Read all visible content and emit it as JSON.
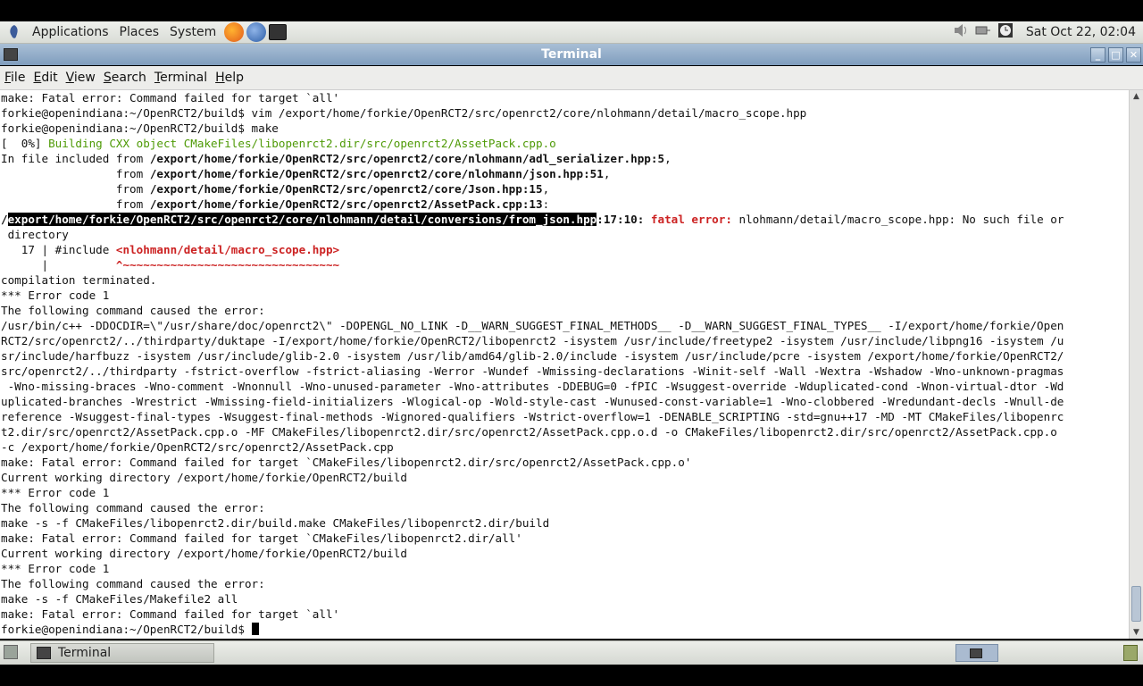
{
  "panel": {
    "menus": [
      "Applications",
      "Places",
      "System"
    ],
    "clock": "Sat Oct 22, 02:04",
    "launchers": [
      "firefox-icon",
      "thunderbird-icon",
      "terminal-launcher-icon"
    ]
  },
  "window": {
    "title": "Terminal",
    "menu": [
      "File",
      "Edit",
      "View",
      "Search",
      "Terminal",
      "Help"
    ],
    "menu_mnemonic": [
      "F",
      "E",
      "V",
      "S",
      "T",
      "H"
    ]
  },
  "terminal": {
    "lines": [
      [
        {
          "t": "make: Fatal error: Command failed for target `all'"
        }
      ],
      [
        {
          "t": "forkie@openindiana:~/OpenRCT2/build$ vim /export/home/forkie/OpenRCT2/src/openrct2/core/nlohmann/detail/macro_scope.hpp"
        }
      ],
      [
        {
          "t": "forkie@openindiana:~/OpenRCT2/build$ make"
        }
      ],
      [
        {
          "t": "[  0%] "
        },
        {
          "t": "Building CXX object CMakeFiles/libopenrct2.dir/src/openrct2/AssetPack.cpp.o",
          "c": "green"
        }
      ],
      [
        {
          "t": "In file included from "
        },
        {
          "t": "/export/home/forkie/OpenRCT2/src/openrct2/core/nlohmann/adl_serializer.hpp:5",
          "c": "bold"
        },
        {
          "t": ","
        }
      ],
      [
        {
          "t": "                 from "
        },
        {
          "t": "/export/home/forkie/OpenRCT2/src/openrct2/core/nlohmann/json.hpp:51",
          "c": "bold"
        },
        {
          "t": ","
        }
      ],
      [
        {
          "t": "                 from "
        },
        {
          "t": "/export/home/forkie/OpenRCT2/src/openrct2/core/Json.hpp:15",
          "c": "bold"
        },
        {
          "t": ","
        }
      ],
      [
        {
          "t": "                 from "
        },
        {
          "t": "/export/home/forkie/OpenRCT2/src/openrct2/AssetPack.cpp:13",
          "c": "bold"
        },
        {
          "t": ":"
        }
      ],
      [
        {
          "t": "/",
          "c": "bold"
        },
        {
          "t": "export/home/forkie/OpenRCT2/src/openrct2/core/nlohmann/detail/conversions/from_json.hpp",
          "c": "sel"
        },
        {
          "t": ":17:10: ",
          "c": "bold"
        },
        {
          "t": "fatal error: ",
          "c": "red"
        },
        {
          "t": "nlohmann/detail/macro_scope.hpp: No such file or"
        }
      ],
      [
        {
          "t": " directory"
        }
      ],
      [
        {
          "t": "   17 | #include "
        },
        {
          "t": "<nlohmann/detail/macro_scope.hpp>",
          "c": "red"
        }
      ],
      [
        {
          "t": "      |          "
        },
        {
          "t": "^~~~~~~~~~~~~~~~~~~~~~~~~~~~~~~~~",
          "c": "red"
        }
      ],
      [
        {
          "t": "compilation terminated."
        }
      ],
      [
        {
          "t": "*** Error code 1"
        }
      ],
      [
        {
          "t": "The following command caused the error:"
        }
      ],
      [
        {
          "t": "/usr/bin/c++ -DDOCDIR=\\\"/usr/share/doc/openrct2\\\" -DOPENGL_NO_LINK -D__WARN_SUGGEST_FINAL_METHODS__ -D__WARN_SUGGEST_FINAL_TYPES__ -I/export/home/forkie/Open"
        }
      ],
      [
        {
          "t": "RCT2/src/openrct2/../thirdparty/duktape -I/export/home/forkie/OpenRCT2/libopenrct2 -isystem /usr/include/freetype2 -isystem /usr/include/libpng16 -isystem /u"
        }
      ],
      [
        {
          "t": "sr/include/harfbuzz -isystem /usr/include/glib-2.0 -isystem /usr/lib/amd64/glib-2.0/include -isystem /usr/include/pcre -isystem /export/home/forkie/OpenRCT2/"
        }
      ],
      [
        {
          "t": "src/openrct2/../thirdparty -fstrict-overflow -fstrict-aliasing -Werror -Wundef -Wmissing-declarations -Winit-self -Wall -Wextra -Wshadow -Wno-unknown-pragmas"
        }
      ],
      [
        {
          "t": " -Wno-missing-braces -Wno-comment -Wnonnull -Wno-unused-parameter -Wno-attributes -DDEBUG=0 -fPIC -Wsuggest-override -Wduplicated-cond -Wnon-virtual-dtor -Wd"
        }
      ],
      [
        {
          "t": "uplicated-branches -Wrestrict -Wmissing-field-initializers -Wlogical-op -Wold-style-cast -Wunused-const-variable=1 -Wno-clobbered -Wredundant-decls -Wnull-de"
        }
      ],
      [
        {
          "t": "reference -Wsuggest-final-types -Wsuggest-final-methods -Wignored-qualifiers -Wstrict-overflow=1 -DENABLE_SCRIPTING -std=gnu++17 -MD -MT CMakeFiles/libopenrc"
        }
      ],
      [
        {
          "t": "t2.dir/src/openrct2/AssetPack.cpp.o -MF CMakeFiles/libopenrct2.dir/src/openrct2/AssetPack.cpp.o.d -o CMakeFiles/libopenrct2.dir/src/openrct2/AssetPack.cpp.o"
        }
      ],
      [
        {
          "t": "-c /export/home/forkie/OpenRCT2/src/openrct2/AssetPack.cpp"
        }
      ],
      [
        {
          "t": "make: Fatal error: Command failed for target `CMakeFiles/libopenrct2.dir/src/openrct2/AssetPack.cpp.o'"
        }
      ],
      [
        {
          "t": "Current working directory /export/home/forkie/OpenRCT2/build"
        }
      ],
      [
        {
          "t": "*** Error code 1"
        }
      ],
      [
        {
          "t": "The following command caused the error:"
        }
      ],
      [
        {
          "t": "make -s -f CMakeFiles/libopenrct2.dir/build.make CMakeFiles/libopenrct2.dir/build"
        }
      ],
      [
        {
          "t": "make: Fatal error: Command failed for target `CMakeFiles/libopenrct2.dir/all'"
        }
      ],
      [
        {
          "t": "Current working directory /export/home/forkie/OpenRCT2/build"
        }
      ],
      [
        {
          "t": "*** Error code 1"
        }
      ],
      [
        {
          "t": "The following command caused the error:"
        }
      ],
      [
        {
          "t": "make -s -f CMakeFiles/Makefile2 all"
        }
      ],
      [
        {
          "t": "make: Fatal error: Command failed for target `all'"
        }
      ],
      [
        {
          "t": "forkie@openindiana:~/OpenRCT2/build$ "
        },
        {
          "cursor": true
        }
      ]
    ]
  },
  "taskbar": {
    "task_label": "Terminal"
  }
}
